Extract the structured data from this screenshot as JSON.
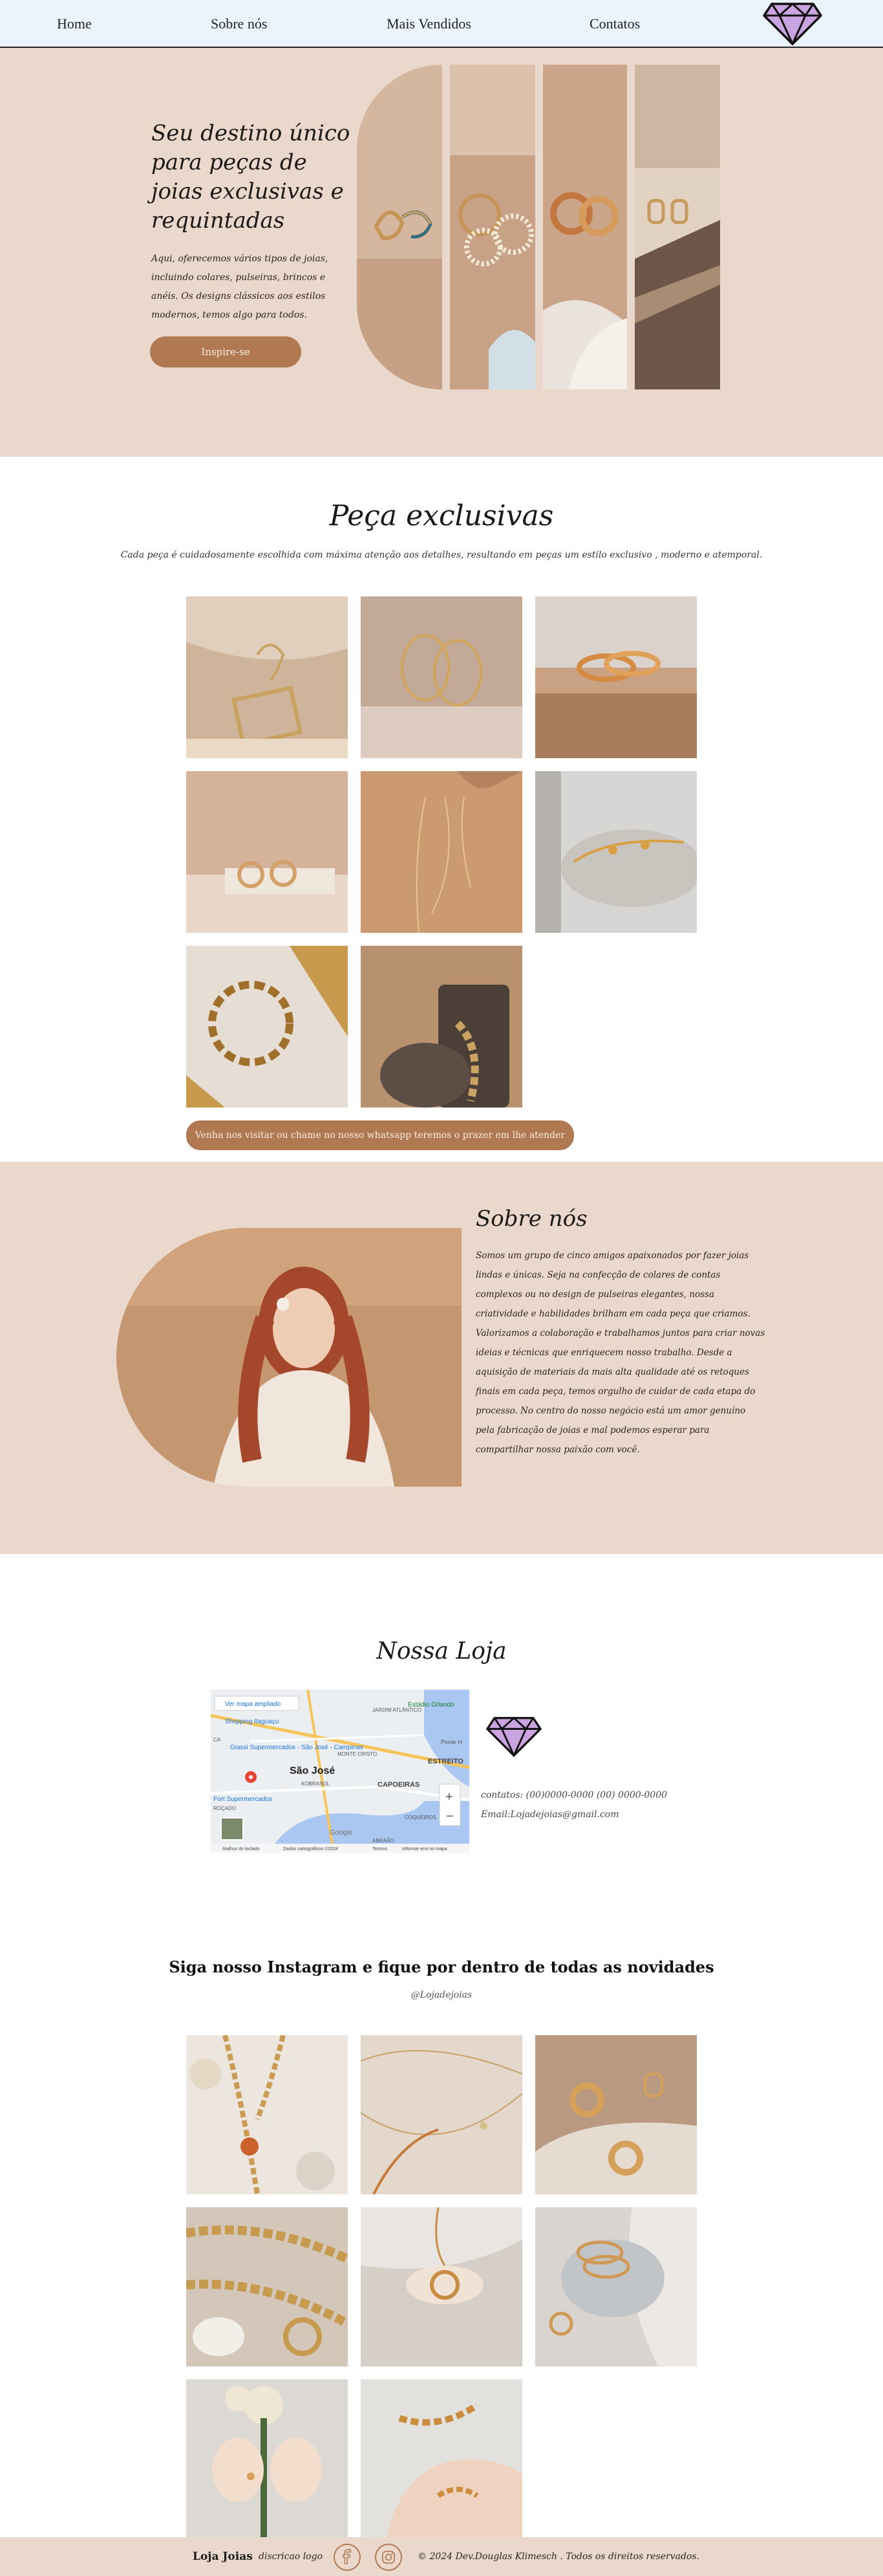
{
  "nav": {
    "items": [
      "Home",
      "Sobre nós",
      "Mais Vendidos",
      "Contatos"
    ],
    "logo_icon": "diamond-icon"
  },
  "hero": {
    "title": "Seu destino único para peças de joias exclusivas e requintadas",
    "text": "Aqui, oferecemos vários tipos de joias, incluindo colares, pulseiras, brincos e anéis. Os designs clássicos aos estilos modernos, temos algo para todos.",
    "button": "Inspire-se"
  },
  "exclusive": {
    "title": "Peça exclusivas",
    "subtitle": "Cada peça é cuidadosamente escolhida com máxima atenção aos detalhes, resultando em peças um estilo exclusivo , moderno e atemporal.",
    "button": "Venha nos visitar ou chame no nosso whatsapp teremos o prazer em lhe atender"
  },
  "about": {
    "title": "Sobre nós",
    "text": "Somos um grupo de cinco amigos apaixonados por fazer joias lindas e únicas. Seja na confecção de colares de contas complexos ou no design de pulseiras elegantes, nossa criatividade e habilidades brilham em cada peça que criamos. Valorizamos a colaboração e trabalhamos juntos para criar novas ideias e técnicas que enriquecem nosso trabalho. Desde a aquisição de materiais da mais alta qualidade até os retoques finais em cada peça, temos orgulho de cuidar de cada etapa do processo. No centro do nosso negócio está um amor genuíno pela fabricação de joias e mal podemos esperar para compartilhar nossa paixão com você."
  },
  "store": {
    "title": "Nossa Loja",
    "map": {
      "link": "Ver mapa ampliado",
      "labels": [
        "Estádio Orlando",
        "Shopping Itaguaçu",
        "Giassi Supermercados - São José - Campinas",
        "São José",
        "CAPOEIRAS",
        "ESTREITO",
        "Ponte H",
        "Fort Supermercados",
        "MONTE CRISTO",
        "JARDIM ATLÂNTICO",
        "KOBRASOL",
        "COQUEIROS",
        "ABRAÃO",
        "CA",
        "ROÇADO",
        "+",
        "−"
      ],
      "attribution": [
        "Google",
        "Atalhos do teclado",
        "Dados cartográficos ©2024",
        "Termos",
        "Informar erro no mapa"
      ]
    },
    "contact": "contatos: (00)0000-0000 (00) 0000-0000",
    "email": "Email:Lojadejoias@gmail.com"
  },
  "instagram": {
    "title": "Siga nosso Instagram e fique por dentro de todas as novidades",
    "handle": "@Lojadejoias"
  },
  "footer": {
    "brand": "Loja Joias",
    "description": "discricao logo",
    "icons": [
      "facebook-icon",
      "instagram-icon"
    ],
    "copyright": "© 2024 Dev.Douglas Klimesch . Todos os direitos reservados."
  },
  "colors": {
    "nav_bg": "#ebf3fd",
    "section_bg": "#ead8cd",
    "accent": "#b07952",
    "text": "#1c1a18",
    "logo_purple": "#c9a4e0"
  }
}
